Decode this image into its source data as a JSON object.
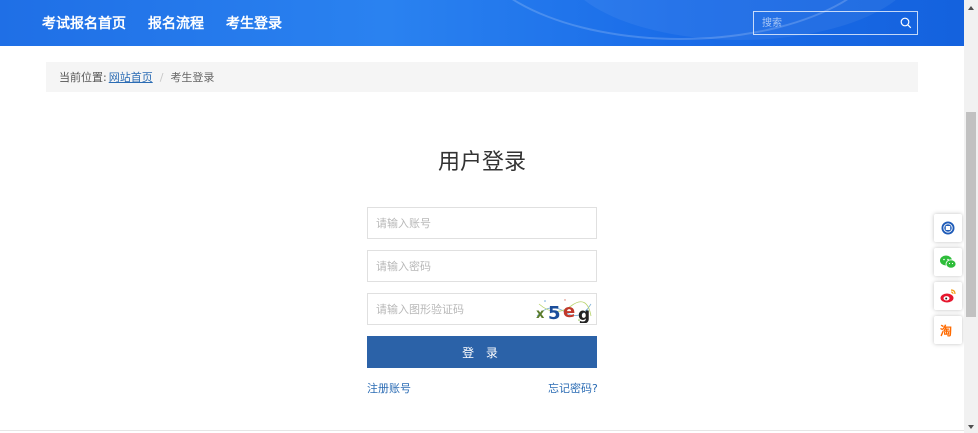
{
  "nav": {
    "items": [
      {
        "label": "考试报名首页"
      },
      {
        "label": "报名流程"
      },
      {
        "label": "考生登录"
      }
    ]
  },
  "search": {
    "placeholder": "搜索",
    "icon": "search-icon"
  },
  "breadcrumb": {
    "prefix": "当前位置:",
    "home": "网站首页",
    "separator": "/",
    "current": "考生登录"
  },
  "login": {
    "title": "用户登录",
    "account_placeholder": "请输入账号",
    "password_placeholder": "请输入密码",
    "captcha_placeholder": "请输入图形验证码",
    "captcha_text": "x5eg",
    "submit_label": "登 录",
    "register_link": "注册账号",
    "forgot_link": "忘记密码?"
  },
  "side_icons": [
    "official-site-icon",
    "wechat-icon",
    "weibo-icon",
    "taobao-icon"
  ],
  "colors": {
    "header": "#1f6fe6",
    "primary_button": "#2b62a8",
    "link": "#2b6cb4"
  }
}
